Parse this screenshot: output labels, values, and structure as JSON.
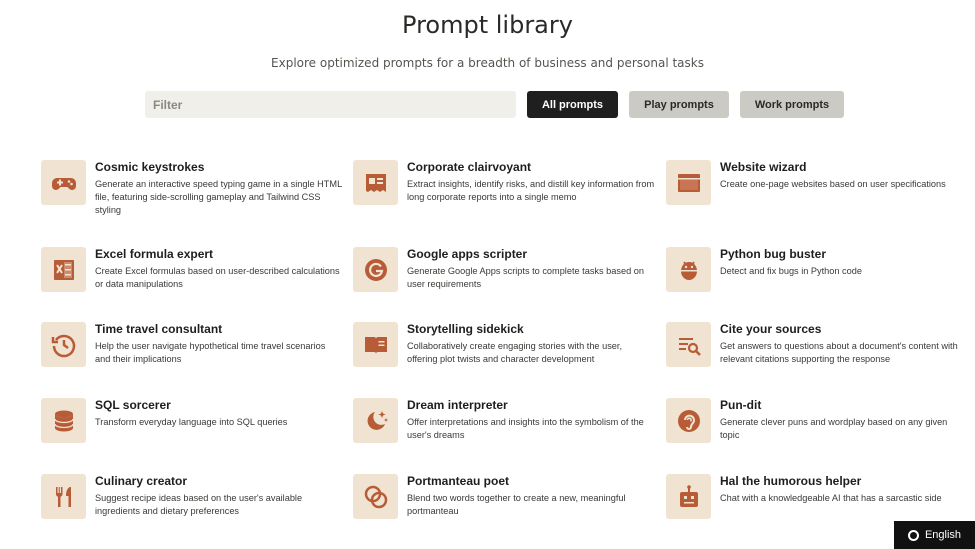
{
  "header": {
    "title": "Prompt library",
    "subtitle": "Explore optimized prompts for a breadth of business and personal tasks"
  },
  "filter": {
    "placeholder": "Filter",
    "value": "",
    "buttons": {
      "all": "All prompts",
      "play": "Play prompts",
      "work": "Work prompts"
    },
    "selected": "All prompts"
  },
  "colors": {
    "icon_bg": "#f0e3d2",
    "icon_fg": "#b85c38",
    "active_button": "#1f1f1f",
    "inactive_button": "#cbcac4"
  },
  "prompts": [
    {
      "title": "Cosmic keystrokes",
      "description": "Generate an interactive speed typing game in a single HTML file, featuring side-scrolling gameplay and Tailwind CSS styling",
      "icon": "gamepad-icon"
    },
    {
      "title": "Corporate clairvoyant",
      "description": "Extract insights, identify risks, and distill key information from long corporate reports into a single memo",
      "icon": "report-icon"
    },
    {
      "title": "Website wizard",
      "description": "Create one-page websites based on user specifications",
      "icon": "browser-window-icon"
    },
    {
      "title": "Excel formula expert",
      "description": "Create Excel formulas based on user-described calculations or data manipulations",
      "icon": "spreadsheet-icon"
    },
    {
      "title": "Google apps scripter",
      "description": "Generate Google Apps scripts to complete tasks based on user requirements",
      "icon": "google-g-icon"
    },
    {
      "title": "Python bug buster",
      "description": "Detect and fix bugs in Python code",
      "icon": "bug-icon"
    },
    {
      "title": "Time travel consultant",
      "description": "Help the user navigate hypothetical time travel scenarios and their implications",
      "icon": "clock-rewind-icon"
    },
    {
      "title": "Storytelling sidekick",
      "description": "Collaboratively create engaging stories with the user, offering plot twists and character development",
      "icon": "open-book-icon"
    },
    {
      "title": "Cite your sources",
      "description": "Get answers to questions about a document's content with relevant citations supporting the response",
      "icon": "document-search-icon"
    },
    {
      "title": "SQL sorcerer",
      "description": "Transform everyday language into SQL queries",
      "icon": "database-icon"
    },
    {
      "title": "Dream interpreter",
      "description": "Offer interpretations and insights into the symbolism of the user's dreams",
      "icon": "moon-stars-icon"
    },
    {
      "title": "Pun-dit",
      "description": "Generate clever puns and wordplay based on any given topic",
      "icon": "ear-icon"
    },
    {
      "title": "Culinary creator",
      "description": "Suggest recipe ideas based on the user's available ingredients and dietary preferences",
      "icon": "fork-knife-icon"
    },
    {
      "title": "Portmanteau poet",
      "description": "Blend two words together to create a new, meaningful portmanteau",
      "icon": "overlapping-circles-icon"
    },
    {
      "title": "Hal the humorous helper",
      "description": "Chat with a knowledgeable AI that has a sarcastic side",
      "icon": "robot-icon"
    }
  ],
  "footer": {
    "language_label": "English",
    "language_icon": "globe-icon"
  }
}
